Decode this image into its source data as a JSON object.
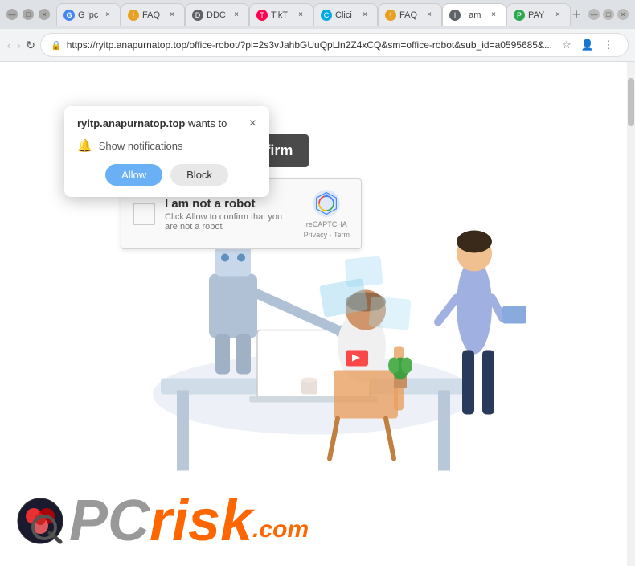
{
  "browser": {
    "tabs": [
      {
        "id": "t1",
        "favicon_color": "#4285F4",
        "favicon_char": "G",
        "label": "G 'pc",
        "active": false
      },
      {
        "id": "t2",
        "favicon_color": "#e8a020",
        "favicon_char": "!",
        "label": "FAQ",
        "active": false
      },
      {
        "id": "t3",
        "favicon_color": "#5f6368",
        "favicon_char": "D",
        "label": "DDC",
        "active": false
      },
      {
        "id": "t4",
        "favicon_color": "#ff0050",
        "favicon_char": "T",
        "label": "TikT",
        "active": false
      },
      {
        "id": "t5",
        "favicon_color": "#00a8e8",
        "favicon_char": "C",
        "label": "Clici",
        "active": false
      },
      {
        "id": "t6",
        "favicon_color": "#e8a020",
        "favicon_char": "!",
        "label": "FAQ",
        "active": false
      },
      {
        "id": "t7",
        "favicon_color": "#5f6368",
        "favicon_char": "I",
        "label": "I am",
        "active": true
      },
      {
        "id": "t8",
        "favicon_color": "#2ea84f",
        "favicon_char": "P",
        "label": "PAY",
        "active": false
      }
    ],
    "address": "https://ryitp.anapurnatop.top/office-robot/?pl=2s3vJahbGUuQpLln2Z4xCQ&sm=office-robot&sub_id=a0595685&...",
    "new_tab_label": "+",
    "back_label": "‹",
    "forward_label": "›",
    "refresh_label": "↻"
  },
  "notification_popup": {
    "title_bold": "ryitp.anapurnatop.top",
    "title_rest": " wants to",
    "permission_text": "Show notifications",
    "allow_label": "Allow",
    "block_label": "Block",
    "close_label": "×"
  },
  "press_allow_banner": {
    "text": "Press Allow to confirm"
  },
  "recaptcha": {
    "title": "I am not a robot",
    "subtitle": "Click Allow to confirm that you are not a robot",
    "brand": "reCAPTCHA",
    "privacy": "Privacy",
    "terms": "Term"
  },
  "pcrisk": {
    "pc_text": "PC",
    "risk_text": "risk",
    "dotcom_text": ".com"
  }
}
